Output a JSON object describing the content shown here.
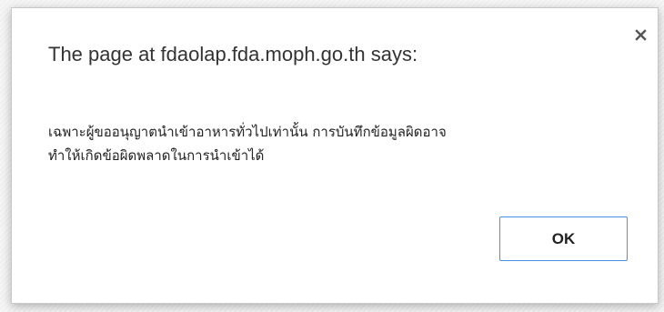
{
  "dialog": {
    "title": "The page at fdaolap.fda.moph.go.th says:",
    "message_line1": "เฉพาะผู้ขออนุญาตนำเข้าอาหารทั่วไปเท่านั้น การบันทึกข้อมูลผิดอาจ",
    "message_line2": "ทำให้เกิดข้อผิดพลาดในการนำเข้าได้",
    "ok_label": "OK",
    "close_icon": "close-icon",
    "accent_color": "#4a90e2"
  }
}
